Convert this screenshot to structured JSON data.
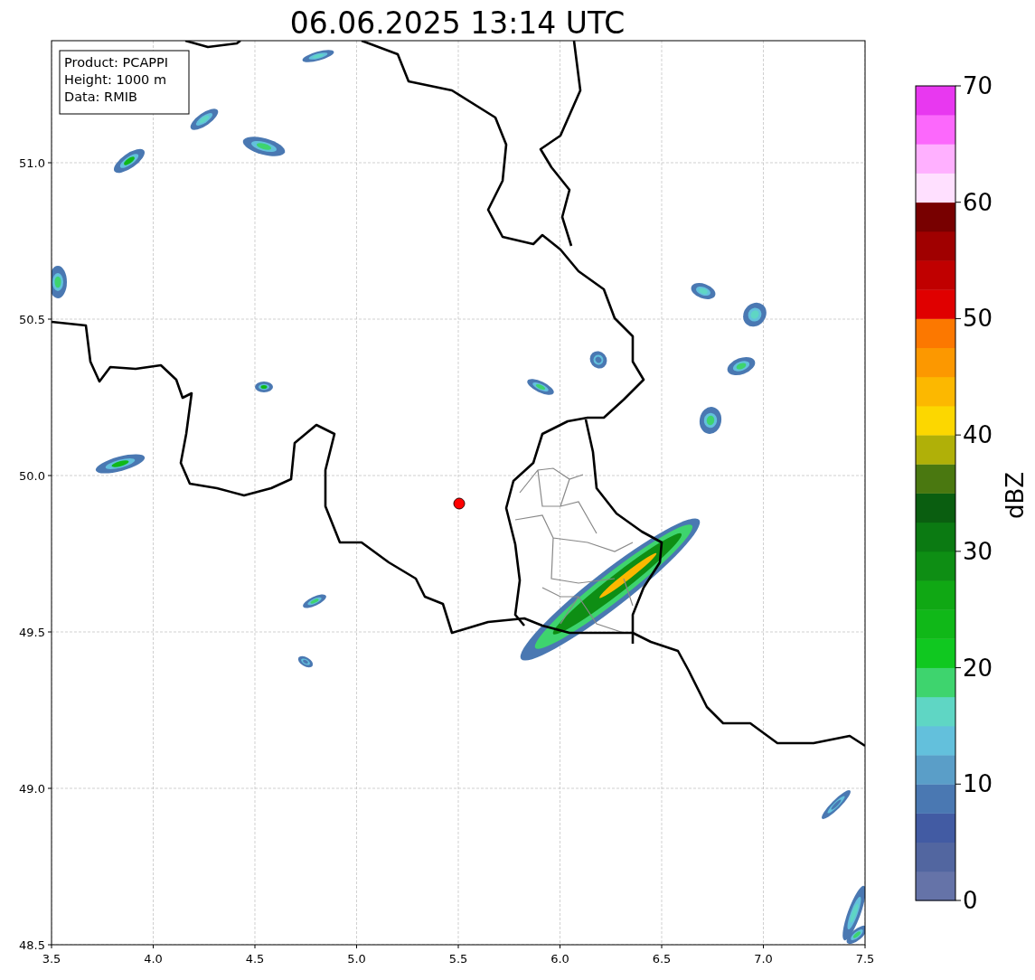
{
  "title": "06.06.2025 13:14 UTC",
  "info_box": [
    "Product: PCAPPI",
    "Height: 1000 m",
    "Data: RMIB"
  ],
  "map": {
    "x_ticks": [
      "3.5",
      "4.0",
      "4.5",
      "5.0",
      "5.5",
      "6.0",
      "6.5",
      "7.0",
      "7.5"
    ],
    "y_ticks": [
      "51.0",
      "50.5",
      "50.0",
      "49.5",
      "49.0",
      "48.5"
    ]
  },
  "colorbar": {
    "label": "dBZ",
    "ticks": [
      "70",
      "60",
      "50",
      "40",
      "30",
      "20",
      "10",
      "0"
    ],
    "bands": [
      {
        "color": "#6573a8"
      },
      {
        "color": "#5266a0"
      },
      {
        "color": "#425ba3"
      },
      {
        "color": "#4a78b2"
      },
      {
        "color": "#5a9ec8"
      },
      {
        "color": "#63c0dc"
      },
      {
        "color": "#5fd6c4"
      },
      {
        "color": "#3ed46e"
      },
      {
        "color": "#10c820"
      },
      {
        "color": "#10b818"
      },
      {
        "color": "#10a814"
      },
      {
        "color": "#0e8e14"
      },
      {
        "color": "#0b7a12"
      },
      {
        "color": "#0a5e10"
      },
      {
        "color": "#4a7810"
      },
      {
        "color": "#b0b008"
      },
      {
        "color": "#fcd700"
      },
      {
        "color": "#fcb800"
      },
      {
        "color": "#fc9800"
      },
      {
        "color": "#fc7800"
      },
      {
        "color": "#e00000"
      },
      {
        "color": "#c00000"
      },
      {
        "color": "#a00000"
      },
      {
        "color": "#780000"
      },
      {
        "color": "#ffe0ff"
      },
      {
        "color": "#ffb0ff"
      },
      {
        "color": "#fc68fc"
      },
      {
        "color": "#e838f0"
      }
    ]
  }
}
